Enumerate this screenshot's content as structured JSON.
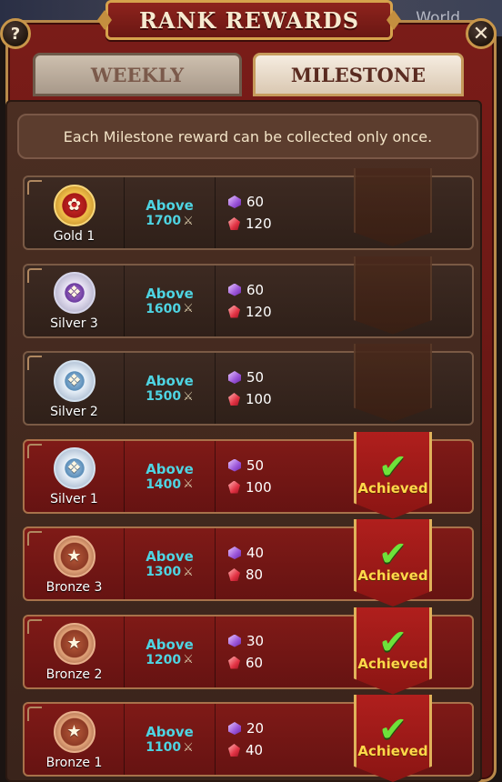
{
  "header": {
    "title": "RANK REWARDS",
    "help_label": "?",
    "close_label": "✕",
    "world_label": "World"
  },
  "tabs": [
    {
      "label": "WEEKLY",
      "active": false
    },
    {
      "label": "MILESTONE",
      "active": true
    }
  ],
  "notice": "Each Milestone reward can be collected only once.",
  "rows": [
    {
      "rank": "Gold 1",
      "badge": "gold",
      "above_label": "Above",
      "points": "1700",
      "gems_purple": "60",
      "gems_red": "120",
      "achieved": false,
      "achieved_label": ""
    },
    {
      "rank": "Silver 3",
      "badge": "silver-purple",
      "above_label": "Above",
      "points": "1600",
      "gems_purple": "60",
      "gems_red": "120",
      "achieved": false,
      "achieved_label": ""
    },
    {
      "rank": "Silver 2",
      "badge": "silver",
      "above_label": "Above",
      "points": "1500",
      "gems_purple": "50",
      "gems_red": "100",
      "achieved": false,
      "achieved_label": ""
    },
    {
      "rank": "Silver 1",
      "badge": "silver",
      "above_label": "Above",
      "points": "1400",
      "gems_purple": "50",
      "gems_red": "100",
      "achieved": true,
      "achieved_label": "Achieved"
    },
    {
      "rank": "Bronze 3",
      "badge": "bronze",
      "above_label": "Above",
      "points": "1300",
      "gems_purple": "40",
      "gems_red": "80",
      "achieved": true,
      "achieved_label": "Achieved"
    },
    {
      "rank": "Bronze 2",
      "badge": "bronze",
      "above_label": "Above",
      "points": "1200",
      "gems_purple": "30",
      "gems_red": "60",
      "achieved": true,
      "achieved_label": "Achieved"
    },
    {
      "rank": "Bronze 1",
      "badge": "bronze",
      "above_label": "Above",
      "points": "1100",
      "gems_purple": "20",
      "gems_red": "40",
      "achieved": true,
      "achieved_label": "Achieved"
    }
  ],
  "colors": {
    "accent_gold": "#d6a24c",
    "above_cyan": "#4ed4e2",
    "achieved_yellow": "#ffd84a",
    "check_green": "#6ee23a"
  }
}
